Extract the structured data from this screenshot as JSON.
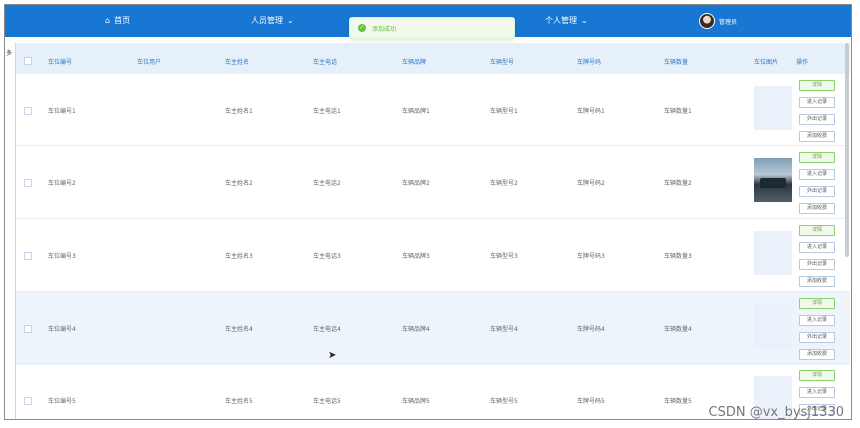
{
  "nav": {
    "home": "首页",
    "people": "人员管理",
    "personal": "个人管理",
    "admin": "管理员"
  },
  "toast": {
    "text": "添加成功"
  },
  "leftmark": "多",
  "table": {
    "headers": [
      "车位编号",
      "车位用户",
      "车主姓名",
      "车主电话",
      "车辆品牌",
      "车辆型号",
      "车牌号码",
      "车辆数量",
      "车位图片",
      "操作"
    ],
    "rows": [
      {
        "code": "车位编号1",
        "user": "",
        "owner": "车主姓名1",
        "phone": "车主电话1",
        "brand": "车辆品牌1",
        "model": "车辆型号1",
        "plate": "车牌号码1",
        "count": "车辆数量1",
        "img": "blank"
      },
      {
        "code": "车位编号2",
        "user": "",
        "owner": "车主姓名2",
        "phone": "车主电话2",
        "brand": "车辆品牌2",
        "model": "车辆型号2",
        "plate": "车牌号码2",
        "count": "车辆数量2",
        "img": "photo"
      },
      {
        "code": "车位编号3",
        "user": "",
        "owner": "车主姓名3",
        "phone": "车主电话3",
        "brand": "车辆品牌3",
        "model": "车辆型号3",
        "plate": "车牌号码3",
        "count": "车辆数量3",
        "img": "blank"
      },
      {
        "code": "车位编号4",
        "user": "",
        "owner": "车主姓名4",
        "phone": "车主电话4",
        "brand": "车辆品牌4",
        "model": "车辆型号4",
        "plate": "车牌号码4",
        "count": "车辆数量4",
        "img": "blank"
      },
      {
        "code": "车位编号5",
        "user": "",
        "owner": "车主姓名5",
        "phone": "车主电话5",
        "brand": "车辆品牌5",
        "model": "车辆型号5",
        "plate": "车牌号码5",
        "count": "车辆数量5",
        "img": "blank"
      }
    ],
    "actions": [
      "详情",
      "进入记录",
      "外出记录",
      "添加收费"
    ]
  },
  "watermark": "CSDN @vx_bysj1330",
  "colors": {
    "topbar": "#1877d2",
    "header_text": "#3079c2",
    "success": "#67c23a"
  }
}
